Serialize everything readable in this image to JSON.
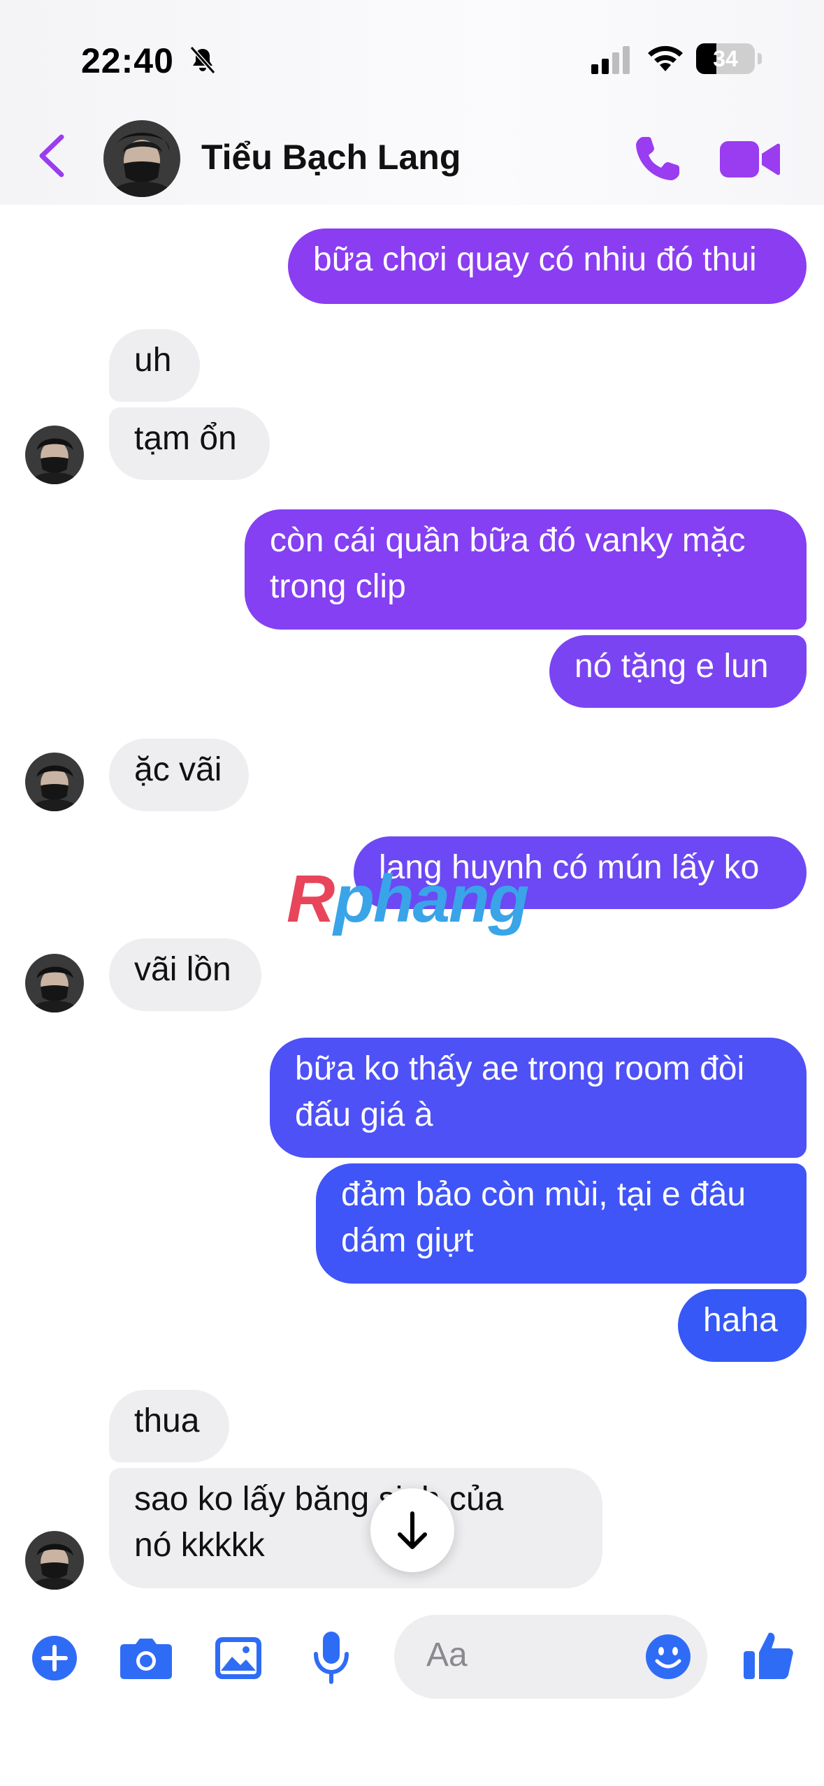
{
  "status_bar": {
    "time": "22:40",
    "battery": "34",
    "battery_fraction": 0.34
  },
  "header": {
    "contact_name": "Tiểu Bạch Lang"
  },
  "colors": {
    "accent": "#9a3cf0",
    "outgoing_top": "#8a3cf2",
    "outgoing_bottom": "#3558f6",
    "incoming": "#eeeef1",
    "composer_icon": "#2f6cf6"
  },
  "messages": [
    {
      "dir": "out",
      "text": "bữa chơi quay có nhiu đó thui"
    },
    {
      "dir": "in",
      "text": "uh"
    },
    {
      "dir": "in",
      "text": "tạm ổn"
    },
    {
      "dir": "out",
      "text": "còn cái quần bữa đó vanky mặc\ntrong clip"
    },
    {
      "dir": "out",
      "text": "nó tặng e lun"
    },
    {
      "dir": "in",
      "text": "ặc vãi"
    },
    {
      "dir": "out",
      "text": "lang huynh có mún lấy ko"
    },
    {
      "dir": "in",
      "text": "vãi lồn"
    },
    {
      "dir": "out",
      "text": "bữa ko thấy ae trong room đòi\nđấu giá à"
    },
    {
      "dir": "out",
      "text": "đảm bảo còn mùi, tại e đâu\ndám giựt"
    },
    {
      "dir": "out",
      "text": "haha"
    },
    {
      "dir": "in",
      "text": "thua"
    },
    {
      "dir": "in",
      "text": "sao ko lấy băng     sinh của\nnó kkkkk"
    }
  ],
  "watermark": {
    "first": "R",
    "rest": "phang"
  },
  "composer": {
    "placeholder": "Aa"
  },
  "icons": [
    "back-icon",
    "phone-icon",
    "video-camera-icon",
    "bell-slash-icon",
    "signal-icon",
    "wifi-icon",
    "battery-icon",
    "plus-icon",
    "camera-icon",
    "photo-icon",
    "microphone-icon",
    "emoji-icon",
    "thumbs-up-icon",
    "arrow-down-icon"
  ]
}
